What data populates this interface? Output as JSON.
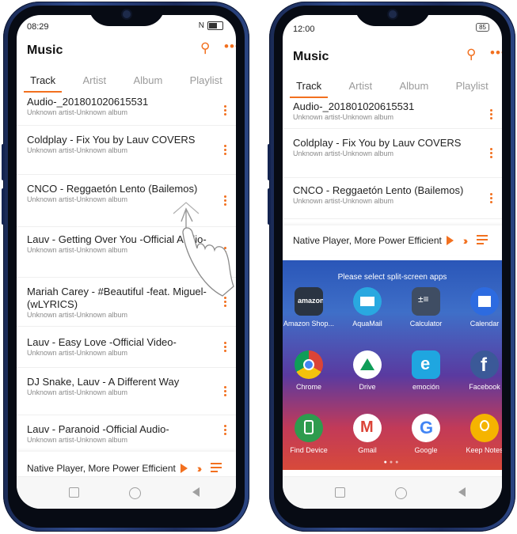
{
  "left": {
    "status_time": "08:29",
    "status_right": "N",
    "app_title": "Music",
    "tabs": [
      "Track",
      "Artist",
      "Album",
      "Playlist"
    ],
    "active_tab": "Track",
    "tracks": [
      {
        "title": "Audio-_201801020615531",
        "sub": "Unknown artist-Unknown album"
      },
      {
        "title": "Coldplay - Fix You by Lauv COVERS",
        "sub": "Unknown artist-Unknown album"
      },
      {
        "title": "CNCO - Reggaetón Lento (Bailemos)",
        "sub": "Unknown artist-Unknown album"
      },
      {
        "title": "Lauv - Getting Over You -Official Audio-",
        "sub": "Unknown artist-Unknown album"
      },
      {
        "title": "Mariah Carey - #Beautiful -feat. Miguel- (wLYRICS)",
        "sub": "Unknown artist-Unknown album"
      },
      {
        "title": "Lauv - Easy Love -Official Video-",
        "sub": "Unknown artist-Unknown album"
      },
      {
        "title": "DJ Snake, Lauv - A Different Way",
        "sub": "Unknown artist-Unknown album"
      },
      {
        "title": "Lauv - Paranoid -Official Audio-",
        "sub": "Unknown artist-Unknown album"
      }
    ],
    "player_text": "Native Player, More Power Efficient"
  },
  "right": {
    "status_time": "12:00",
    "status_right": "85",
    "app_title": "Music",
    "tabs": [
      "Track",
      "Artist",
      "Album",
      "Playlist"
    ],
    "active_tab": "Track",
    "tracks": [
      {
        "title": "Audio-_201801020615531",
        "sub": "Unknown artist-Unknown album"
      },
      {
        "title": "Coldplay - Fix You by Lauv COVERS",
        "sub": "Unknown artist-Unknown album"
      },
      {
        "title": "CNCO - Reggaetón Lento (Bailemos)",
        "sub": "Unknown artist-Unknown album"
      }
    ],
    "player_text": "Native Player, More Power Efficient",
    "split_title": "Please select split-screen apps",
    "apps": [
      {
        "name": "Amazon Shop...",
        "icon": "amazon-icon",
        "color": "#2a3442"
      },
      {
        "name": "AquaMail",
        "icon": "aquamail-icon",
        "color": "#29a8e0"
      },
      {
        "name": "Calculator",
        "icon": "calculator-icon",
        "color": "#3f4d63"
      },
      {
        "name": "Calendar",
        "icon": "calendar-icon",
        "color": "#2d6be0"
      },
      {
        "name": "Chrome",
        "icon": "chrome-icon",
        "color": "#db4437"
      },
      {
        "name": "Drive",
        "icon": "drive-icon",
        "color": "#ffffff"
      },
      {
        "name": "emoción",
        "icon": "emocion-icon",
        "color": "#1fa6e0"
      },
      {
        "name": "Facebook",
        "icon": "facebook-icon",
        "color": "#3b5998"
      },
      {
        "name": "Find Device",
        "icon": "find-device-icon",
        "color": "#2e9b4e"
      },
      {
        "name": "Gmail",
        "icon": "gmail-icon",
        "color": "#ffffff"
      },
      {
        "name": "Google",
        "icon": "google-icon",
        "color": "#ffffff"
      },
      {
        "name": "Keep Notes",
        "icon": "keep-notes-icon",
        "color": "#f5b400"
      }
    ]
  },
  "accent": "#f2701f"
}
